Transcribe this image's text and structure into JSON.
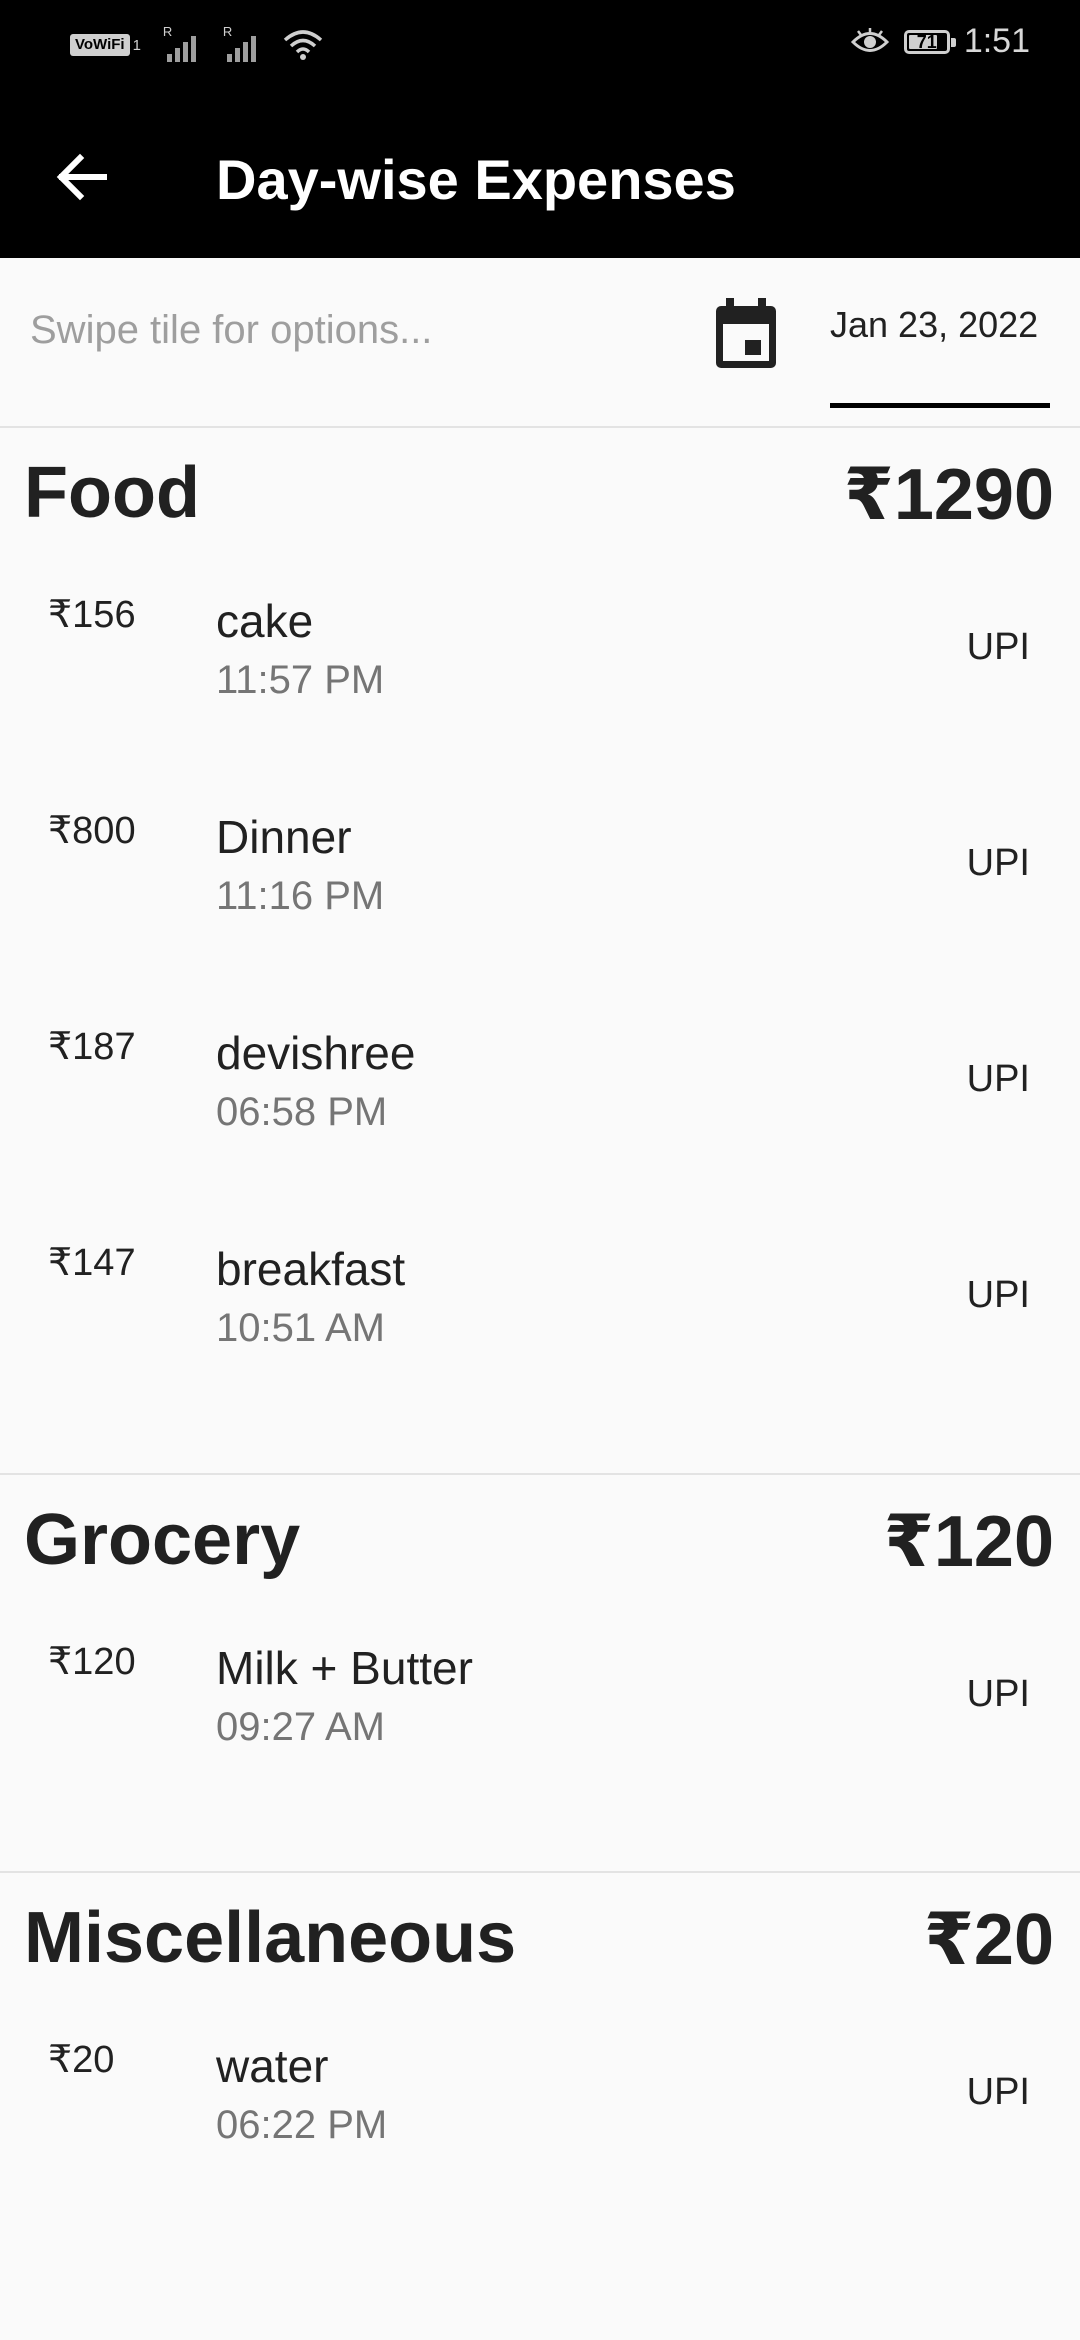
{
  "status_bar": {
    "vowifi_label": "VoWiFi",
    "vowifi_sub": "1",
    "roaming_1": "R",
    "roaming_2": "R",
    "battery_level": "71",
    "time": "1:51"
  },
  "app_bar": {
    "title": "Day-wise Expenses",
    "back_icon": "arrow-back-icon"
  },
  "filter": {
    "hint": "Swipe tile for options...",
    "calendar_icon": "calendar-icon",
    "date": "Jan 23, 2022"
  },
  "categories": [
    {
      "name": "Food",
      "total": "₹1290",
      "entries": [
        {
          "amount": "₹156",
          "title": "cake",
          "time": "11:57 PM",
          "mode": "UPI"
        },
        {
          "amount": "₹800",
          "title": "Dinner",
          "time": "11:16 PM",
          "mode": "UPI"
        },
        {
          "amount": "₹187",
          "title": "devishree",
          "time": "06:58 PM",
          "mode": "UPI"
        },
        {
          "amount": "₹147",
          "title": "breakfast",
          "time": "10:51 AM",
          "mode": "UPI"
        }
      ]
    },
    {
      "name": "Grocery",
      "total": "₹120",
      "entries": [
        {
          "amount": "₹120",
          "title": "Milk + Butter",
          "time": "09:27 AM",
          "mode": "UPI"
        }
      ]
    },
    {
      "name": "Miscellaneous",
      "total": "₹20",
      "entries": [
        {
          "amount": "₹20",
          "title": "water",
          "time": "06:22 PM",
          "mode": "UPI"
        }
      ]
    }
  ],
  "colors": {
    "app_bar_bg": "#000000",
    "background": "#fafafa",
    "primary_text": "#212121",
    "secondary_text": "#757575",
    "hint_text": "#9e9e9e"
  }
}
